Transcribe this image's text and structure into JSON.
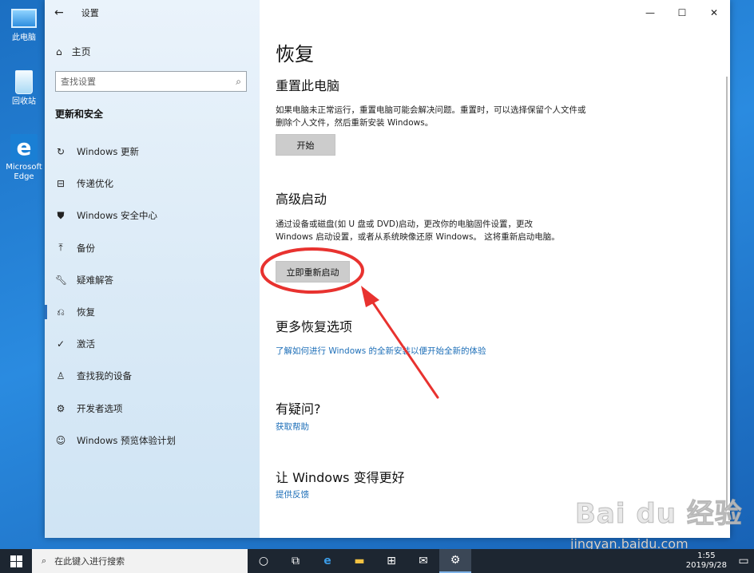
{
  "desktop": {
    "icons": [
      {
        "label": "此电脑"
      },
      {
        "label": "回收站"
      },
      {
        "label": "Microsoft Edge",
        "label_line1": "Microsoft",
        "label_line2": "Edge"
      }
    ]
  },
  "window": {
    "title": "设置",
    "sidebar": {
      "home_label": "主页",
      "search_placeholder": "查找设置",
      "section_title": "更新和安全",
      "items": [
        {
          "label": "Windows 更新",
          "icon": "refresh-icon"
        },
        {
          "label": "传递优化",
          "icon": "delivery-icon"
        },
        {
          "label": "Windows 安全中心",
          "icon": "shield-icon"
        },
        {
          "label": "备份",
          "icon": "backup-icon"
        },
        {
          "label": "疑难解答",
          "icon": "wrench-icon"
        },
        {
          "label": "恢复",
          "icon": "recovery-icon",
          "active": true
        },
        {
          "label": "激活",
          "icon": "check-circle-icon"
        },
        {
          "label": "查找我的设备",
          "icon": "person-pin-icon"
        },
        {
          "label": "开发者选项",
          "icon": "developer-icon"
        },
        {
          "label": "Windows 预览体验计划",
          "icon": "insider-icon"
        }
      ]
    },
    "main": {
      "page_title": "恢复",
      "reset": {
        "heading": "重置此电脑",
        "description": "如果电脑未正常运行，重置电脑可能会解决问题。重置时，可以选择保留个人文件或删除个人文件，然后重新安装 Windows。",
        "button": "开始"
      },
      "advanced": {
        "heading": "高级启动",
        "description": "通过设备或磁盘(如 U 盘或 DVD)启动，更改你的电脑固件设置，更改 Windows 启动设置，或者从系统映像还原 Windows。 这将重新启动电脑。",
        "button": "立即重新启动"
      },
      "more": {
        "heading": "更多恢复选项",
        "link": "了解如何进行 Windows 的全新安装以便开始全新的体验"
      },
      "question": {
        "heading": "有疑问?",
        "link": "获取帮助"
      },
      "feedback": {
        "heading": "让 Windows 变得更好",
        "link": "提供反馈"
      }
    }
  },
  "taskbar": {
    "search_placeholder": "在此键入进行搜索",
    "clock_time": "1:55",
    "clock_date": "2019/9/28"
  },
  "watermark": {
    "brand": "Bai du 经验",
    "url": "jingyan.baidu.com"
  },
  "colors": {
    "accent": "#1e6fb8",
    "annotation_red": "#e8322f",
    "sidebar_bg": "#dcebf7",
    "taskbar_bg": "#1d2631"
  }
}
